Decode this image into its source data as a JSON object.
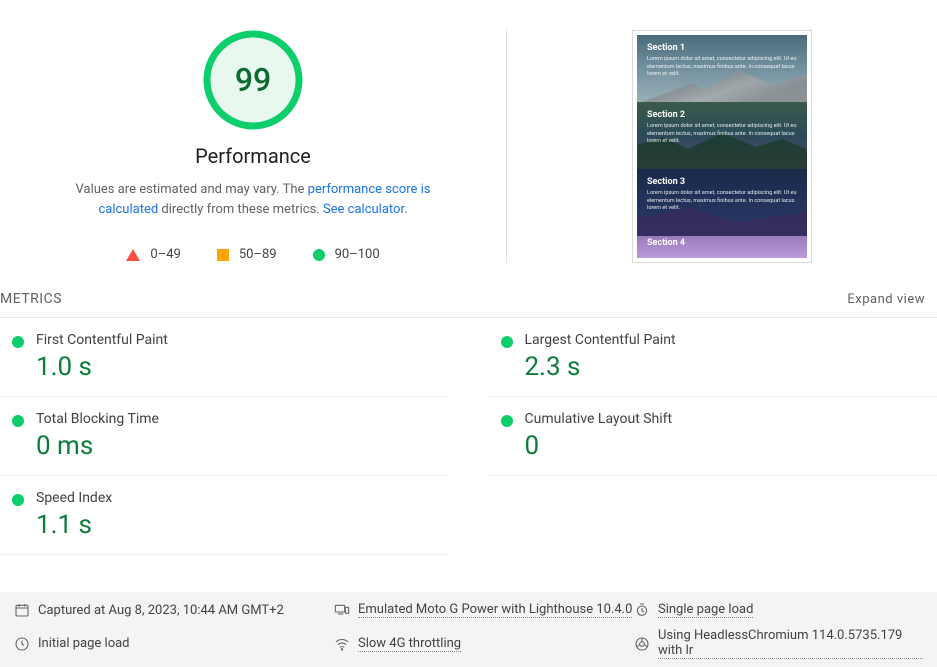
{
  "gauge": {
    "score": "99",
    "title": "Performance",
    "circumference": 289,
    "offset": 3
  },
  "disclaimer": {
    "prefix": "Values are estimated and may vary. The ",
    "link1": "performance score is calculated",
    "mid": " directly from these metrics. ",
    "link2": "See calculator."
  },
  "legend": {
    "fail": "0–49",
    "avg": "50–89",
    "pass": "90–100"
  },
  "preview": {
    "sections": [
      {
        "title": "Section 1",
        "text": "Lorem ipsum dolor sit amet, consectetur adipiscing elit. Ut eu elementum lectus, maximus finibus ante. In consequat lacus lorem et velit."
      },
      {
        "title": "Section 2",
        "text": "Lorem ipsum dolor sit amet, consectetur adipiscing elit. Ut eu elementum lectus, maximus finibus ante. In consequat lacus lorem et velit."
      },
      {
        "title": "Section 3",
        "text": "Lorem ipsum dolor sit amet, consectetur adipiscing elit. Ut eu elementum lectus, maximus finibus ante. In consequat lacus lorem et velit."
      },
      {
        "title": "Section 4",
        "text": ""
      }
    ]
  },
  "metrics_header": "METRICS",
  "expand_view": "Expand view",
  "metrics": [
    {
      "label": "First Contentful Paint",
      "value": "1.0 s"
    },
    {
      "label": "Largest Contentful Paint",
      "value": "2.3 s"
    },
    {
      "label": "Total Blocking Time",
      "value": "0 ms"
    },
    {
      "label": "Cumulative Layout Shift",
      "value": "0"
    },
    {
      "label": "Speed Index",
      "value": "1.1 s"
    }
  ],
  "footer": {
    "captured": "Captured at Aug 8, 2023, 10:44 AM GMT+2",
    "emulated": "Emulated Moto G Power with Lighthouse 10.4.0",
    "single": "Single page load",
    "initial": "Initial page load",
    "throttle": "Slow 4G throttling",
    "browser": "Using HeadlessChromium 114.0.5735.179 with lr"
  }
}
